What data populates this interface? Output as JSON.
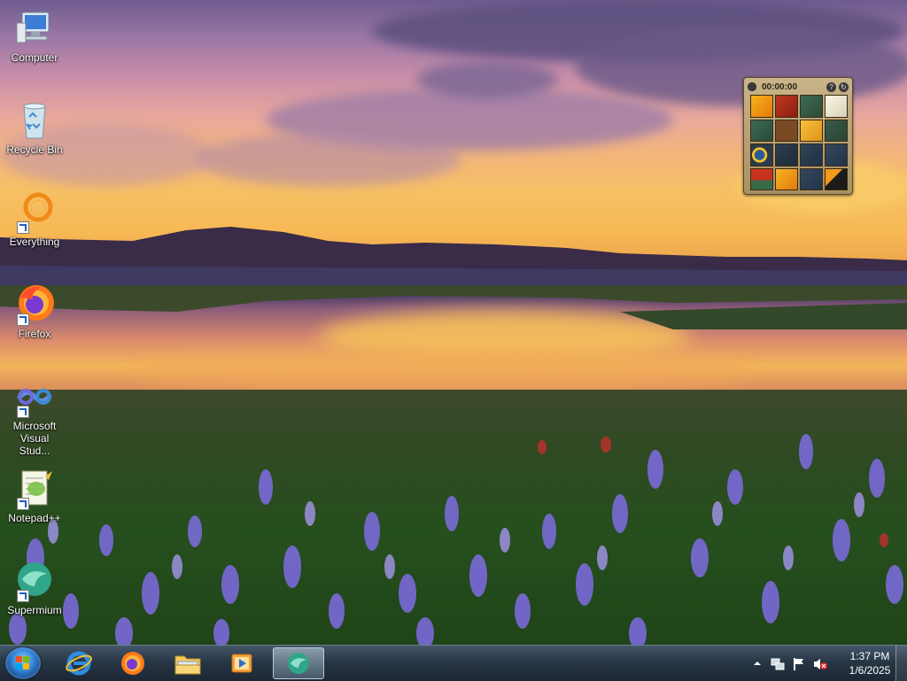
{
  "desktop": {
    "icons": [
      {
        "label": "Computer",
        "icon": "computer-icon",
        "shortcut": false
      },
      {
        "label": "Recycle Bin",
        "icon": "recycle-bin-icon",
        "shortcut": false
      },
      {
        "label": "Everything",
        "icon": "everything-search-icon",
        "shortcut": true
      },
      {
        "label": "Firefox",
        "icon": "firefox-icon",
        "shortcut": true
      },
      {
        "label": "Microsoft Visual Stud...",
        "icon": "visual-studio-icon",
        "shortcut": true
      },
      {
        "label": "Notepad++",
        "icon": "notepadpp-icon",
        "shortcut": true
      },
      {
        "label": "Supermium",
        "icon": "supermium-icon",
        "shortcut": true
      }
    ]
  },
  "gadget": {
    "name": "picture-puzzle-gadget",
    "timer": "00:00:00",
    "help_label": "?",
    "refresh_label": "↻"
  },
  "taskbar": {
    "start": "start-button",
    "pinned": [
      {
        "name": "internet-explorer",
        "icon": "internet-explorer-icon",
        "active": false
      },
      {
        "name": "firefox",
        "icon": "firefox-icon",
        "active": false
      },
      {
        "name": "file-explorer",
        "icon": "folder-icon",
        "active": false
      },
      {
        "name": "media-player",
        "icon": "media-player-icon",
        "active": false
      },
      {
        "name": "supermium",
        "icon": "supermium-icon",
        "active": true
      }
    ],
    "tray": {
      "show_hidden": "chevron-up-icon",
      "network": "network-icon",
      "action_center": "flag-icon",
      "volume": "volume-muted-icon",
      "time": "1:37 PM",
      "date": "1/6/2025"
    }
  },
  "colors": {
    "accent_blue": "#2f7ed0",
    "clock_text": "#ffffff"
  }
}
